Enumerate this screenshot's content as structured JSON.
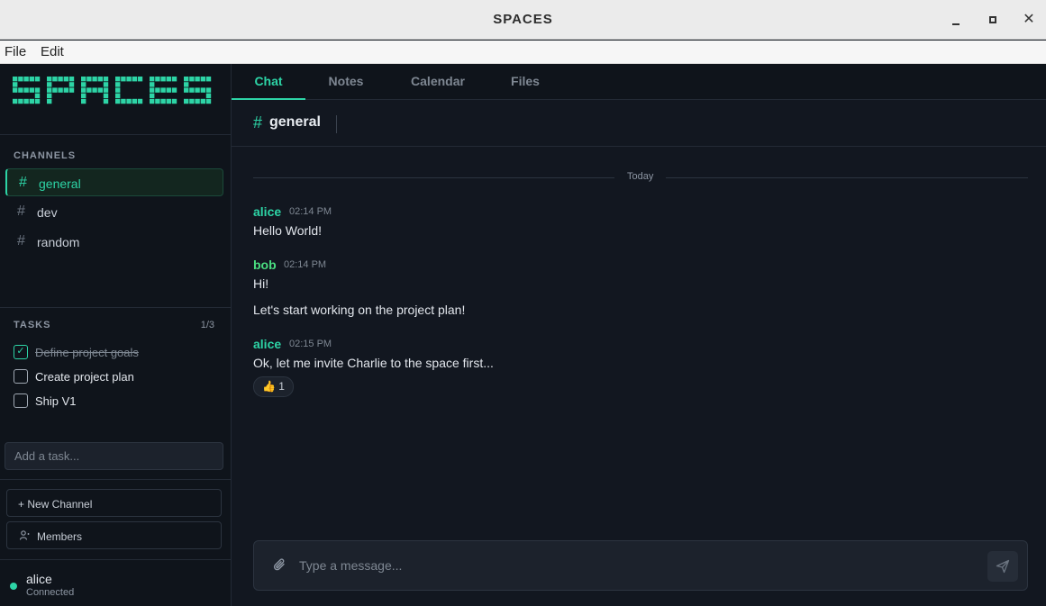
{
  "window": {
    "title": "SPACES",
    "minimize_icon": "minimize-icon",
    "maximize_icon": "maximize-icon",
    "close_icon": "close-icon"
  },
  "menu": {
    "file": "File",
    "edit": "Edit"
  },
  "sidebar": {
    "logo_text": "SPACES",
    "channels_label": "CHANNELS",
    "channels": [
      {
        "name": "general",
        "active": true
      },
      {
        "name": "dev",
        "active": false
      },
      {
        "name": "random",
        "active": false
      }
    ],
    "tasks_label": "TASKS",
    "tasks_count": "1/3",
    "tasks": [
      {
        "label": "Define project goals",
        "done": true
      },
      {
        "label": "Create project plan",
        "done": false
      },
      {
        "label": "Ship V1",
        "done": false
      }
    ],
    "add_task_placeholder": "Add a task...",
    "new_channel_label": "+ New Channel",
    "members_label": "Members",
    "user": {
      "name": "alice",
      "status": "Connected"
    }
  },
  "tabs": [
    "Chat",
    "Notes",
    "Calendar",
    "Files"
  ],
  "active_tab": "Chat",
  "channel_header": {
    "hash": "#",
    "name": "general"
  },
  "date_separator": "Today",
  "messages": [
    {
      "author": "alice",
      "time": "02:14 PM",
      "lines": [
        "Hello World!"
      ]
    },
    {
      "author": "bob",
      "time": "02:14 PM",
      "lines": [
        "Hi!",
        "Let's start working on the project plan!"
      ]
    },
    {
      "author": "alice",
      "time": "02:15 PM",
      "lines": [
        "Ok, let me invite Charlie to the space first..."
      ]
    }
  ],
  "reaction": {
    "emoji": "👍",
    "count": "1"
  },
  "composer": {
    "placeholder": "Type a message..."
  },
  "colors": {
    "accent": "#2dd4a6",
    "bob": "#4ade80",
    "background": "#121720",
    "sidebar": "#0f141b"
  }
}
